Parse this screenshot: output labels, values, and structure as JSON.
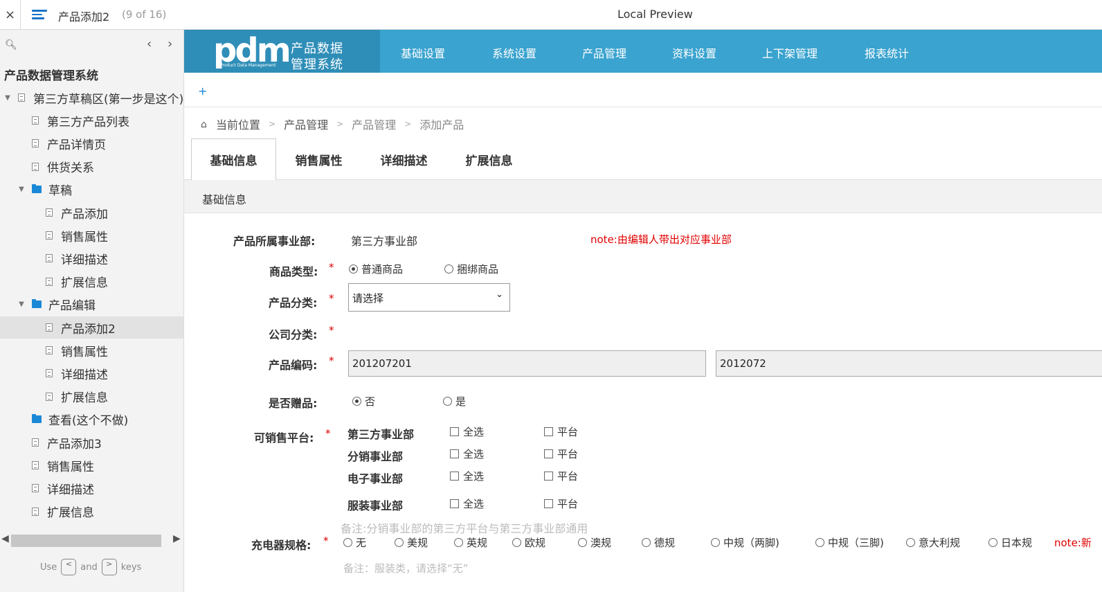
{
  "topbar": {
    "close_glyph": "×",
    "page_title": "产品添加2",
    "page_count": "(9 of 16)",
    "window_title": "Local Preview"
  },
  "sidebar": {
    "prev_glyph": "‹",
    "next_glyph": "›",
    "root_title": "产品数据管理系统",
    "items": [
      {
        "label": "第三方草稿区(第一步是这个)",
        "type": "page",
        "twisty": "▼"
      },
      {
        "label": "第三方产品列表",
        "type": "page"
      },
      {
        "label": "产品详情页",
        "type": "page"
      },
      {
        "label": "供货关系",
        "type": "page"
      },
      {
        "label": "草稿",
        "type": "folder",
        "twisty": "▼"
      },
      {
        "label": "产品添加",
        "type": "page"
      },
      {
        "label": "销售属性",
        "type": "page"
      },
      {
        "label": "详细描述",
        "type": "page"
      },
      {
        "label": "扩展信息",
        "type": "page"
      },
      {
        "label": "产品编辑",
        "type": "folder",
        "twisty": "▼"
      },
      {
        "label": "产品添加2",
        "type": "page",
        "selected": true
      },
      {
        "label": "销售属性",
        "type": "page"
      },
      {
        "label": "详细描述",
        "type": "page"
      },
      {
        "label": "扩展信息",
        "type": "page"
      },
      {
        "label": "查看(这个不做)",
        "type": "folder"
      },
      {
        "label": "产品添加3",
        "type": "page"
      },
      {
        "label": "销售属性",
        "type": "page"
      },
      {
        "label": "详细描述",
        "type": "page"
      },
      {
        "label": "扩展信息",
        "type": "page"
      }
    ],
    "key_hint": {
      "use": "Use",
      "key_left": "<",
      "and": "and",
      "key_right": ">",
      "keys": "keys"
    }
  },
  "header": {
    "logo_text": "pdm",
    "logo_sub": "Product Data Management",
    "logo_cn_1": "产品数据",
    "logo_cn_2": "管理系统",
    "nav": [
      "基础设置",
      "系统设置",
      "产品管理",
      "资料设置",
      "上下架管理",
      "报表统计"
    ],
    "accent": "#3aa3cf"
  },
  "plus": "+",
  "breadcrumb": {
    "home_glyph": "⌂",
    "items": [
      "当前位置",
      "产品管理",
      "产品管理",
      "添加产品"
    ],
    "sep": ">"
  },
  "tabs": [
    "基础信息",
    "销售属性",
    "详细描述",
    "扩展信息"
  ],
  "section_title": "基础信息",
  "form": {
    "dept_label": "产品所属事业部:",
    "dept_value": "第三方事业部",
    "dept_note": "note:由编辑人带出对应事业部",
    "goods_type_label": "商品类型:",
    "goods_type_options": [
      "普通商品",
      "捆绑商品"
    ],
    "category_label": "产品分类:",
    "category_value": "请选择",
    "company_cat_label": "公司分类:",
    "code_label": "产品编码:",
    "code_value_1": "201207201",
    "code_value_2": "2012072",
    "gift_label": "是否赠品:",
    "gift_options": [
      "否",
      "是"
    ],
    "platform_label": "可销售平台:",
    "depts": [
      "第三方事业部",
      "分销事业部",
      "电子事业部",
      "服装事业部"
    ],
    "select_all": "全选",
    "platform": "平台",
    "platform_note": "备注:分销事业部的第三方平台与第三方事业部通用",
    "charger_label": "充电器规格:",
    "charger_options": [
      "无",
      "美规",
      "英规",
      "欧规",
      "澳规",
      "德规",
      "中规（两脚)",
      "中规（三脚)",
      "意大利规",
      "日本规"
    ],
    "charger_note": "note:新",
    "charger_hint": "备注：服装类，请选择“无”",
    "required_mark": "*"
  }
}
